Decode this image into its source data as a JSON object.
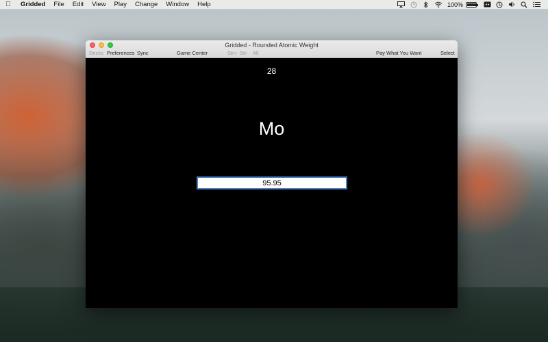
{
  "menubar": {
    "app_name": "Gridded",
    "items": [
      "File",
      "Edit",
      "View",
      "Play",
      "Change",
      "Window",
      "Help"
    ],
    "battery_text": "100%",
    "battery_level": 1.0
  },
  "window": {
    "title": "Gridded - Rounded Atomic Weight",
    "toolbar": {
      "decks": "Decks",
      "preferences": "Preferences",
      "sync": "Sync",
      "game_center": "Game Center",
      "str_plus": "Str+",
      "str_minus": "Str-",
      "all": "All",
      "pay": "Pay What You Want",
      "select": "Select"
    }
  },
  "card": {
    "atomic_number": "28",
    "symbol": "Mo",
    "answer_value": "95.95"
  }
}
